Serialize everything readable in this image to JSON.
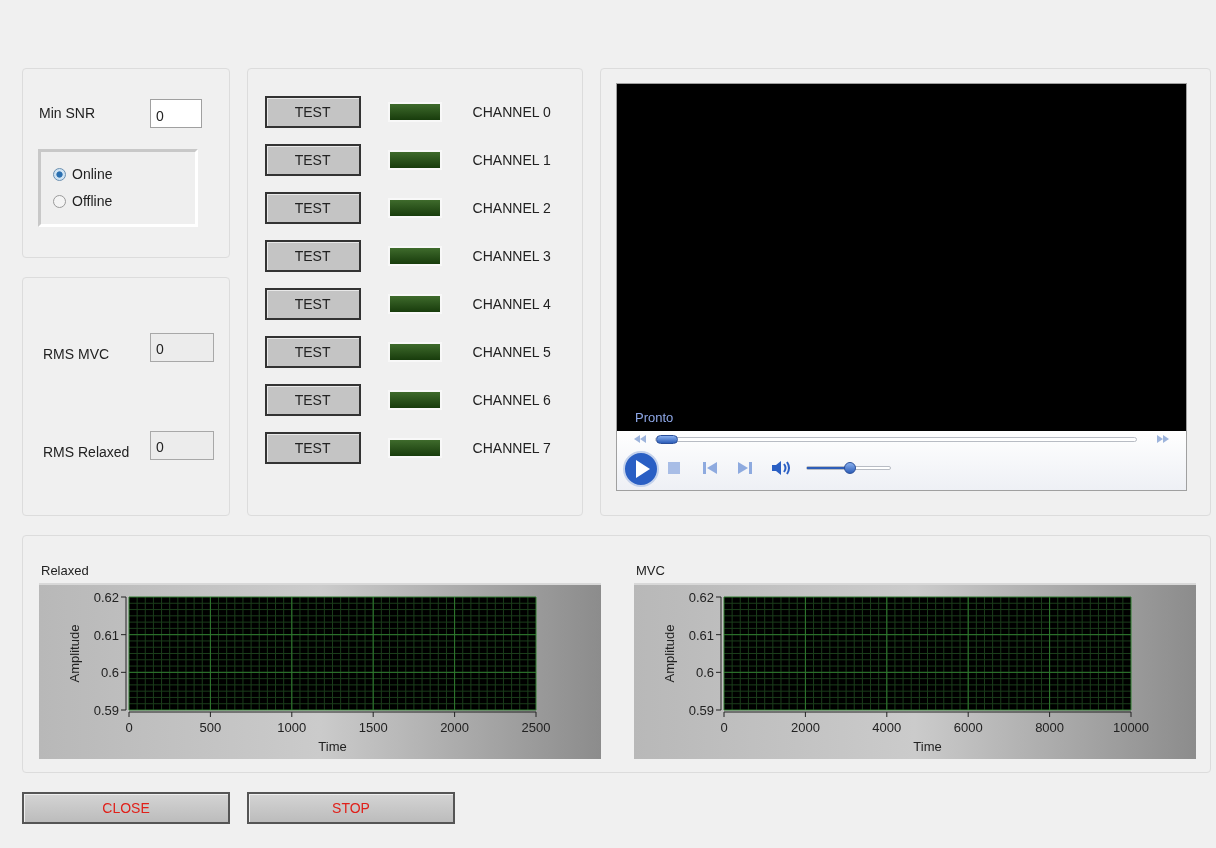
{
  "min_snr": {
    "label": "Min SNR",
    "value": "0"
  },
  "mode_options": [
    {
      "label": "Online",
      "selected": true
    },
    {
      "label": "Offline",
      "selected": false
    }
  ],
  "rms_fields": [
    {
      "label": "RMS MVC",
      "value": "0"
    },
    {
      "label": "RMS Relaxed",
      "value": "0"
    }
  ],
  "channels": [
    {
      "button": "TEST",
      "label": "CHANNEL 0",
      "on": false
    },
    {
      "button": "TEST",
      "label": "CHANNEL 1",
      "on": false
    },
    {
      "button": "TEST",
      "label": "CHANNEL 2",
      "on": false
    },
    {
      "button": "TEST",
      "label": "CHANNEL 3",
      "on": false
    },
    {
      "button": "TEST",
      "label": "CHANNEL 4",
      "on": false
    },
    {
      "button": "TEST",
      "label": "CHANNEL 5",
      "on": false
    },
    {
      "button": "TEST",
      "label": "CHANNEL 6",
      "on": false
    },
    {
      "button": "TEST",
      "label": "CHANNEL 7",
      "on": false
    }
  ],
  "video_player": {
    "status": "Pronto",
    "seek": {
      "level": 0
    },
    "volume": {
      "level": 0.5
    }
  },
  "charts": [
    {
      "chart_data": {
        "type": "line",
        "title": "Relaxed",
        "xlabel": "Time",
        "ylabel": "Amplitude",
        "xlim": [
          0,
          2500
        ],
        "ylim": [
          0.59,
          0.62
        ],
        "xticks": [
          0,
          500,
          1000,
          1500,
          2000,
          2500
        ],
        "yticks": [
          0.59,
          0.6,
          0.61,
          0.62
        ],
        "grid": true
      }
    },
    {
      "chart_data": {
        "type": "line",
        "title": "MVC",
        "xlabel": "Time",
        "ylabel": "Amplitude",
        "xlim": [
          0,
          10000
        ],
        "ylim": [
          0.59,
          0.62
        ],
        "xticks": [
          0,
          2000,
          4000,
          6000,
          8000,
          10000
        ],
        "yticks": [
          0.59,
          0.6,
          0.61,
          0.62
        ],
        "grid": true
      }
    }
  ],
  "buttons": [
    "CLOSE",
    "STOP"
  ]
}
